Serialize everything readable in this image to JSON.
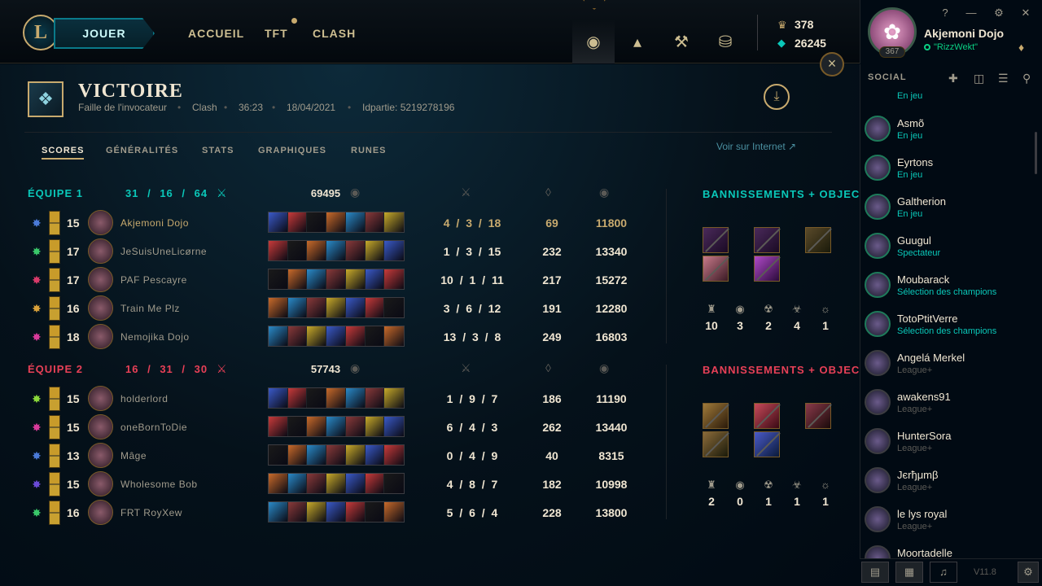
{
  "topbar": {
    "play_label": "JOUER",
    "nav": [
      "ACCUEIL",
      "TFT",
      "CLASH"
    ],
    "rp": "378",
    "be": "26245"
  },
  "profile": {
    "name": "Akjemoni Dojo",
    "status": "\"RizzWekt\"",
    "level": "367",
    "window_controls": [
      "?",
      "—",
      "⚙",
      "✕"
    ]
  },
  "match": {
    "result": "VICTOIRE",
    "map": "Faille de l'invocateur",
    "mode": "Clash",
    "duration": "36:23",
    "date": "18/04/2021",
    "game_id": "Idpartie: 5219278196",
    "tabs": [
      "SCORES",
      "GÉNÉRALITÉS",
      "STATS",
      "GRAPHIQUES",
      "RUNES"
    ],
    "web_link": "Voir sur Internet ↗"
  },
  "team1": {
    "label": "ÉQUIPE 1",
    "kills": "31",
    "deaths": "16",
    "assists": "64",
    "gold": "69495",
    "color": "#0ac8b9",
    "players": [
      {
        "level": "15",
        "name": "Akjemoni Dojo",
        "kda": "4 / 3 / 18",
        "cs": "69",
        "gold": "11800",
        "rune": "#4a7ad8"
      },
      {
        "level": "17",
        "name": "JeSuisUneLicørne",
        "kda": "1 / 3 / 15",
        "cs": "232",
        "gold": "13340",
        "rune": "#3ac86a"
      },
      {
        "level": "17",
        "name": "PAF Pescayre",
        "kda": "10 / 1 / 11",
        "cs": "217",
        "gold": "15272",
        "rune": "#d83a6a"
      },
      {
        "level": "16",
        "name": "Train Me Plz",
        "kda": "3 / 6 / 12",
        "cs": "191",
        "gold": "12280",
        "rune": "#d8a03a"
      },
      {
        "level": "18",
        "name": "Nemojika Dojo",
        "kda": "13 / 3 / 8",
        "cs": "249",
        "gold": "16803",
        "rune": "#d83a9a"
      }
    ]
  },
  "team2": {
    "label": "ÉQUIPE 2",
    "kills": "16",
    "deaths": "31",
    "assists": "30",
    "gold": "57743",
    "color": "#e84057",
    "players": [
      {
        "level": "15",
        "name": "holderlord",
        "kda": "1 / 9 / 7",
        "cs": "186",
        "gold": "11190",
        "rune": "#8ad83a"
      },
      {
        "level": "15",
        "name": "oneBornToDie",
        "kda": "6 / 4 / 3",
        "cs": "262",
        "gold": "13440",
        "rune": "#d83a9a"
      },
      {
        "level": "13",
        "name": "Mâge",
        "kda": "0 / 4 / 9",
        "cs": "40",
        "gold": "8315",
        "rune": "#4a7ad8"
      },
      {
        "level": "15",
        "name": "Wholesome Bob",
        "kda": "4 / 8 / 7",
        "cs": "182",
        "gold": "10998",
        "rune": "#6a4ad8"
      },
      {
        "level": "16",
        "name": "FRT RoyXew",
        "kda": "5 / 6 / 4",
        "cs": "228",
        "gold": "13800",
        "rune": "#3ac86a"
      }
    ]
  },
  "bans": {
    "title": "BANNISSEMENTS + OBJECTIFS",
    "team1_objectives": [
      "10",
      "3",
      "2",
      "4",
      "1"
    ],
    "team2_objectives": [
      "2",
      "0",
      "1",
      "1",
      "1"
    ]
  },
  "social": {
    "title": "SOCIAL",
    "partial_top": "En jeu",
    "friends": [
      {
        "name": "Asmõ",
        "status": "En jeu",
        "online": true
      },
      {
        "name": "Eyrtons",
        "status": "En jeu",
        "online": true
      },
      {
        "name": "Galtherion",
        "status": "En jeu",
        "online": true
      },
      {
        "name": "Guugul",
        "status": "Spectateur",
        "online": true
      },
      {
        "name": "Moubarack",
        "status": "Sélection des champions",
        "online": true
      },
      {
        "name": "TotoPtitVerre",
        "status": "Sélection des champions",
        "online": true
      },
      {
        "name": "Angelá Merkel",
        "status": "League+",
        "online": false
      },
      {
        "name": "awakens91",
        "status": "League+",
        "online": false
      },
      {
        "name": "HunterSora",
        "status": "League+",
        "online": false
      },
      {
        "name": "Jєrђμmβ",
        "status": "League+",
        "online": false
      },
      {
        "name": "le lys royal",
        "status": "League+",
        "online": false
      },
      {
        "name": "Moortadelle",
        "status": "",
        "online": false
      }
    ],
    "version": "V11.8"
  }
}
